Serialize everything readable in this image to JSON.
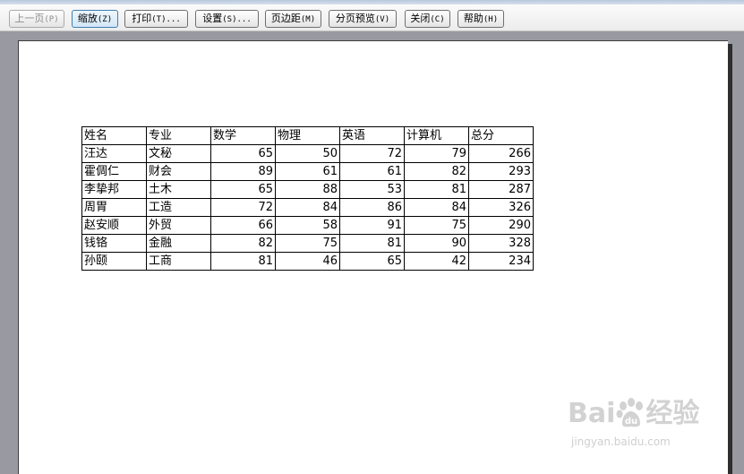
{
  "toolbar": {
    "buttons": [
      {
        "label": "上一页",
        "key": "(P)"
      },
      {
        "label": "缩放",
        "key": "(Z)"
      },
      {
        "label": "打印",
        "key": "(T)..."
      },
      {
        "label": "设置",
        "key": "(S)..."
      },
      {
        "label": "页边距",
        "key": "(M)"
      },
      {
        "label": "分页预览",
        "key": "(V)"
      },
      {
        "label": "关闭",
        "key": "(C)"
      },
      {
        "label": "帮助",
        "key": "(H)"
      }
    ]
  },
  "sheet": {
    "headers": [
      "姓名",
      "专业",
      "数学",
      "物理",
      "英语",
      "计算机",
      "总分"
    ],
    "rows": [
      [
        "汪达",
        "文秘",
        "65",
        "50",
        "72",
        "79",
        "266"
      ],
      [
        "霍倜仁",
        "财会",
        "89",
        "61",
        "61",
        "82",
        "293"
      ],
      [
        "李挚邦",
        "土木",
        "65",
        "88",
        "53",
        "81",
        "287"
      ],
      [
        "周胃",
        "工造",
        "72",
        "84",
        "86",
        "84",
        "326"
      ],
      [
        "赵安顺",
        "外贸",
        "66",
        "58",
        "91",
        "75",
        "290"
      ],
      [
        "钱铬",
        "金融",
        "82",
        "75",
        "81",
        "90",
        "328"
      ],
      [
        "孙颐",
        "工商",
        "81",
        "46",
        "65",
        "42",
        "234"
      ]
    ]
  },
  "watermark": {
    "logo_left": "Bai",
    "logo_right": "经验",
    "url": "jingyan.baidu.com"
  },
  "colors": {
    "background": "#999aa1",
    "paper": "#ffffff",
    "focus_border": "#3c7fb1"
  }
}
